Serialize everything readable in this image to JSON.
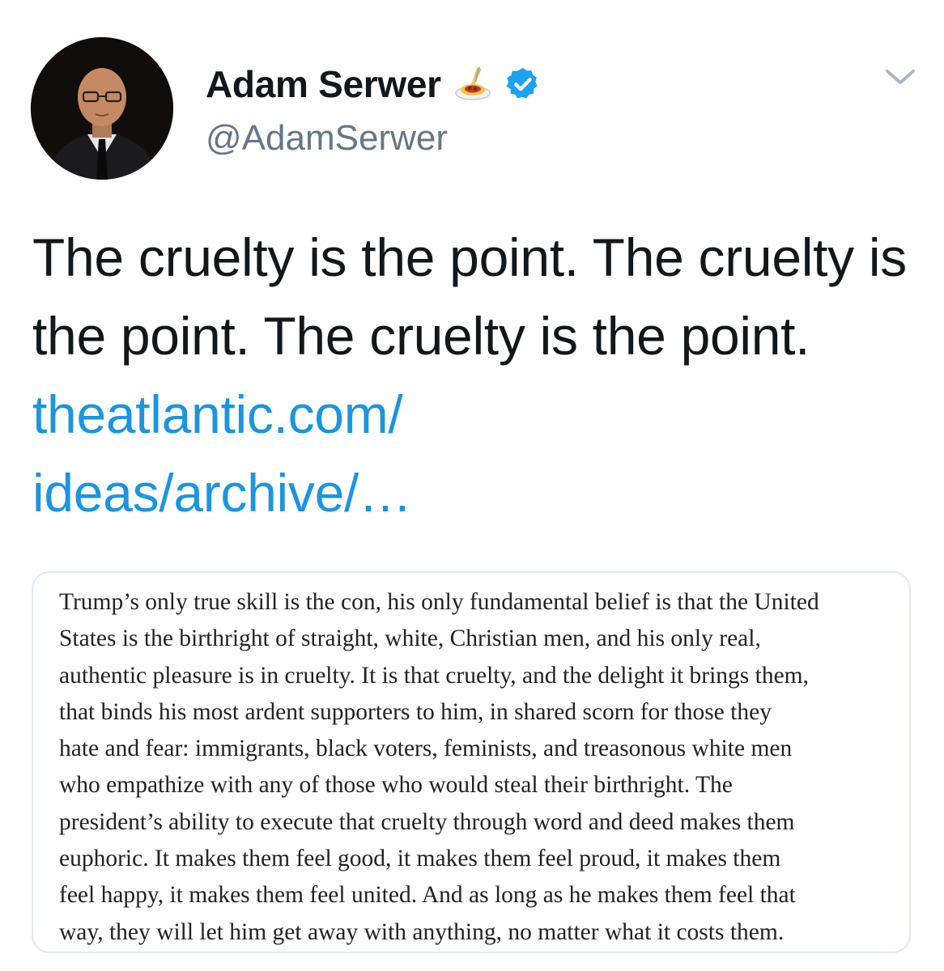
{
  "tweet": {
    "display_name": "Adam Serwer",
    "handle": "@AdamSerwer",
    "name_emoji_icon": "spaghetti-icon",
    "verified_icon": "verified-badge-icon",
    "menu_icon": "chevron-down-icon",
    "text": "The cruelty is the point. The cruelty is the point. The cruelty is the point. ",
    "link_text_line1": "theatlantic.com/",
    "link_text_line2": "ideas/archive/…",
    "colors": {
      "link": "#1b95e0",
      "handle": "#657786",
      "verified": "#1da1f2",
      "card_border": "#e1e8ed"
    }
  },
  "quote_image": {
    "lines": [
      "Trump’s only true skill is the con, his only fundamental belief is that the United",
      "States is the birthright of straight, white, Christian men, and his only real,",
      "authentic pleasure is in cruelty. It is that cruelty, and the delight it brings them,",
      "that binds his most ardent supporters to him, in shared scorn for those they",
      "hate and fear: immigrants, black voters, feminists, and treasonous white men",
      "who empathize with any of those who would steal their birthright. The",
      "president’s ability to execute that cruelty through word and deed makes them",
      "euphoric. It makes them feel good, it makes them feel proud, it makes them",
      "feel happy, it makes them feel united. And as long as he makes them feel that",
      "way, they will let him get away with anything, no matter what it costs them."
    ]
  }
}
